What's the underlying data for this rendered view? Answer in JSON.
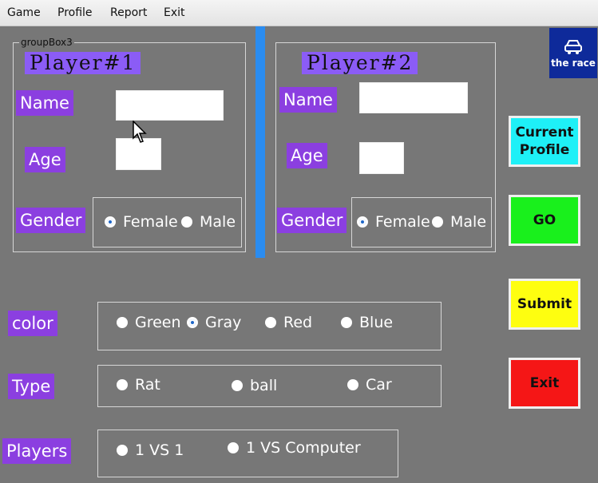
{
  "menu": [
    "Game",
    "Profile",
    "Report",
    "Exit"
  ],
  "player1": {
    "groupbox_caption": "groupBox3",
    "title": "Player#1",
    "name_label": "Name",
    "age_label": "Age",
    "gender_label": "Gender",
    "name_value": "",
    "age_value": "",
    "gender_options": [
      {
        "label": "Female",
        "selected": true
      },
      {
        "label": "Male",
        "selected": false
      }
    ]
  },
  "player2": {
    "title": "Player#2",
    "name_label": "Name",
    "age_label": "Age",
    "gender_label": "Gender",
    "name_value": "",
    "age_value": "",
    "gender_options": [
      {
        "label": "Female",
        "selected": true
      },
      {
        "label": "Male",
        "selected": false
      }
    ]
  },
  "color": {
    "label": "color",
    "options": [
      {
        "label": "Green",
        "selected": false
      },
      {
        "label": "Gray",
        "selected": true
      },
      {
        "label": "Red",
        "selected": false
      },
      {
        "label": "Blue",
        "selected": false
      }
    ]
  },
  "type": {
    "label": "Type",
    "options": [
      {
        "label": "Rat",
        "selected": false
      },
      {
        "label": "ball",
        "selected": false
      },
      {
        "label": "Car",
        "selected": false
      }
    ]
  },
  "players": {
    "label": "Players",
    "options": [
      {
        "label": "1 VS 1",
        "selected": false
      },
      {
        "label": "1 VS Computer",
        "selected": false
      }
    ]
  },
  "buttons": {
    "current_profile": "Current Profile",
    "go": "GO",
    "submit": "Submit",
    "exit": "Exit"
  },
  "logo": {
    "text": "the race",
    "icon": "car-icon"
  },
  "colors": {
    "background": "#777777",
    "label_purple": "#8b3fe0",
    "divider": "#2a8cf0",
    "current_profile": "#1ef0f7",
    "go": "#19f01c",
    "submit": "#fefe10",
    "exit": "#f51616",
    "logo_bg": "#0e2a9a"
  }
}
